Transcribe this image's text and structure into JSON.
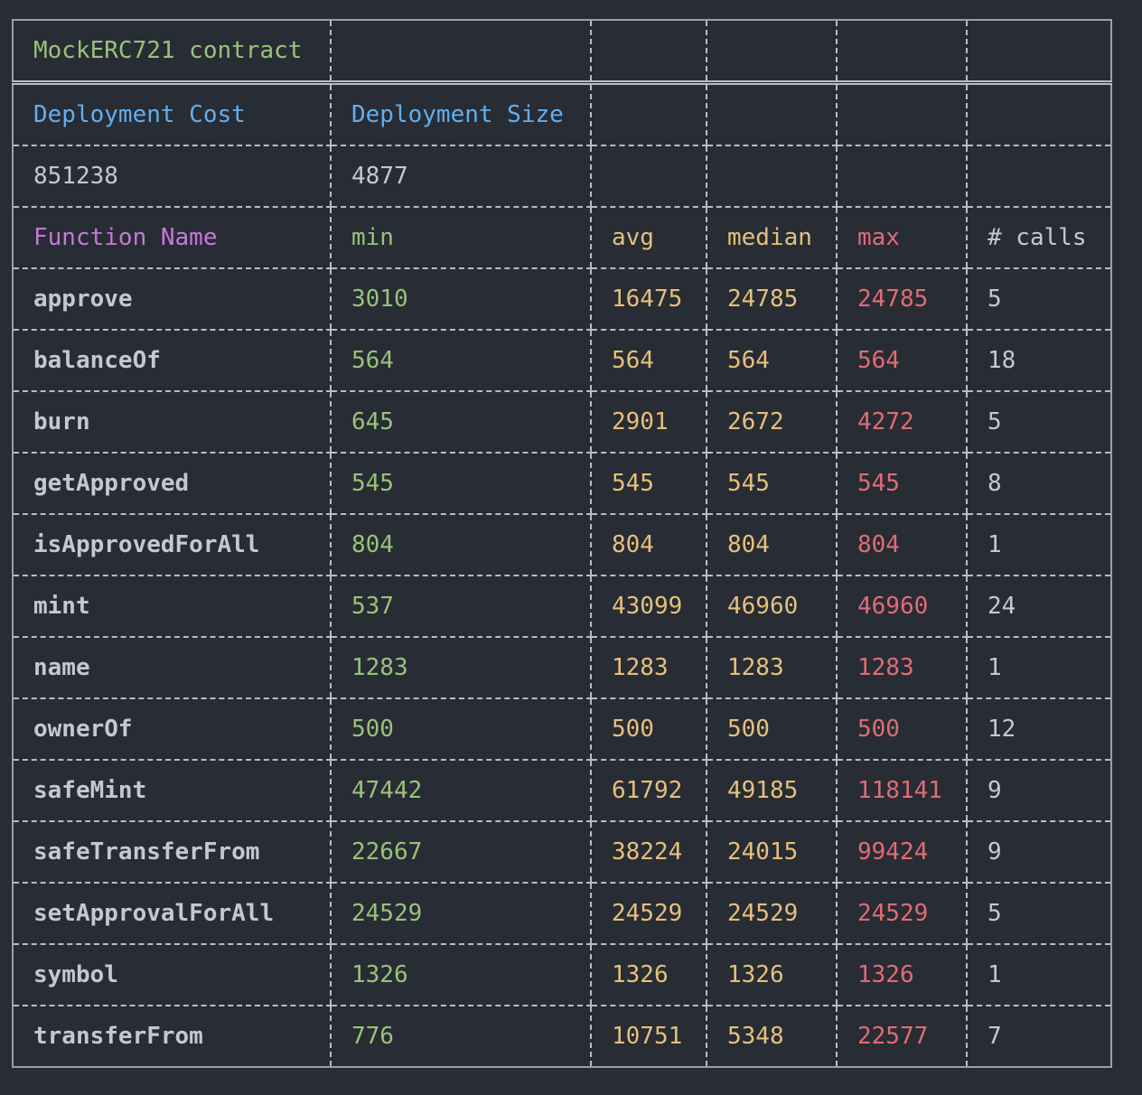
{
  "contract_title": "MockERC721 contract",
  "deployment": {
    "cost_header": "Deployment Cost",
    "size_header": "Deployment Size",
    "cost": "851238",
    "size": "4877"
  },
  "headers": {
    "function_name": "Function Name",
    "min": "min",
    "avg": "avg",
    "median": "median",
    "max": "max",
    "calls": "# calls"
  },
  "rows": [
    {
      "name": "approve",
      "min": "3010",
      "avg": "16475",
      "median": "24785",
      "max": "24785",
      "calls": "5"
    },
    {
      "name": "balanceOf",
      "min": "564",
      "avg": "564",
      "median": "564",
      "max": "564",
      "calls": "18"
    },
    {
      "name": "burn",
      "min": "645",
      "avg": "2901",
      "median": "2672",
      "max": "4272",
      "calls": "5"
    },
    {
      "name": "getApproved",
      "min": "545",
      "avg": "545",
      "median": "545",
      "max": "545",
      "calls": "8"
    },
    {
      "name": "isApprovedForAll",
      "min": "804",
      "avg": "804",
      "median": "804",
      "max": "804",
      "calls": "1"
    },
    {
      "name": "mint",
      "min": "537",
      "avg": "43099",
      "median": "46960",
      "max": "46960",
      "calls": "24"
    },
    {
      "name": "name",
      "min": "1283",
      "avg": "1283",
      "median": "1283",
      "max": "1283",
      "calls": "1"
    },
    {
      "name": "ownerOf",
      "min": "500",
      "avg": "500",
      "median": "500",
      "max": "500",
      "calls": "12"
    },
    {
      "name": "safeMint",
      "min": "47442",
      "avg": "61792",
      "median": "49185",
      "max": "118141",
      "calls": "9"
    },
    {
      "name": "safeTransferFrom",
      "min": "22667",
      "avg": "38224",
      "median": "24015",
      "max": "99424",
      "calls": "9"
    },
    {
      "name": "setApprovalForAll",
      "min": "24529",
      "avg": "24529",
      "median": "24529",
      "max": "24529",
      "calls": "5"
    },
    {
      "name": "symbol",
      "min": "1326",
      "avg": "1326",
      "median": "1326",
      "max": "1326",
      "calls": "1"
    },
    {
      "name": "transferFrom",
      "min": "776",
      "avg": "10751",
      "median": "5348",
      "max": "22577",
      "calls": "7"
    }
  ],
  "colors": {
    "background": "#282c34",
    "title": "#98c379",
    "deployment_header": "#61afef",
    "function_header": "#c678dd",
    "min": "#98c379",
    "avg": "#e5c07b",
    "median": "#e5c07b",
    "max": "#e06c75",
    "plain": "#c5c8ce"
  }
}
